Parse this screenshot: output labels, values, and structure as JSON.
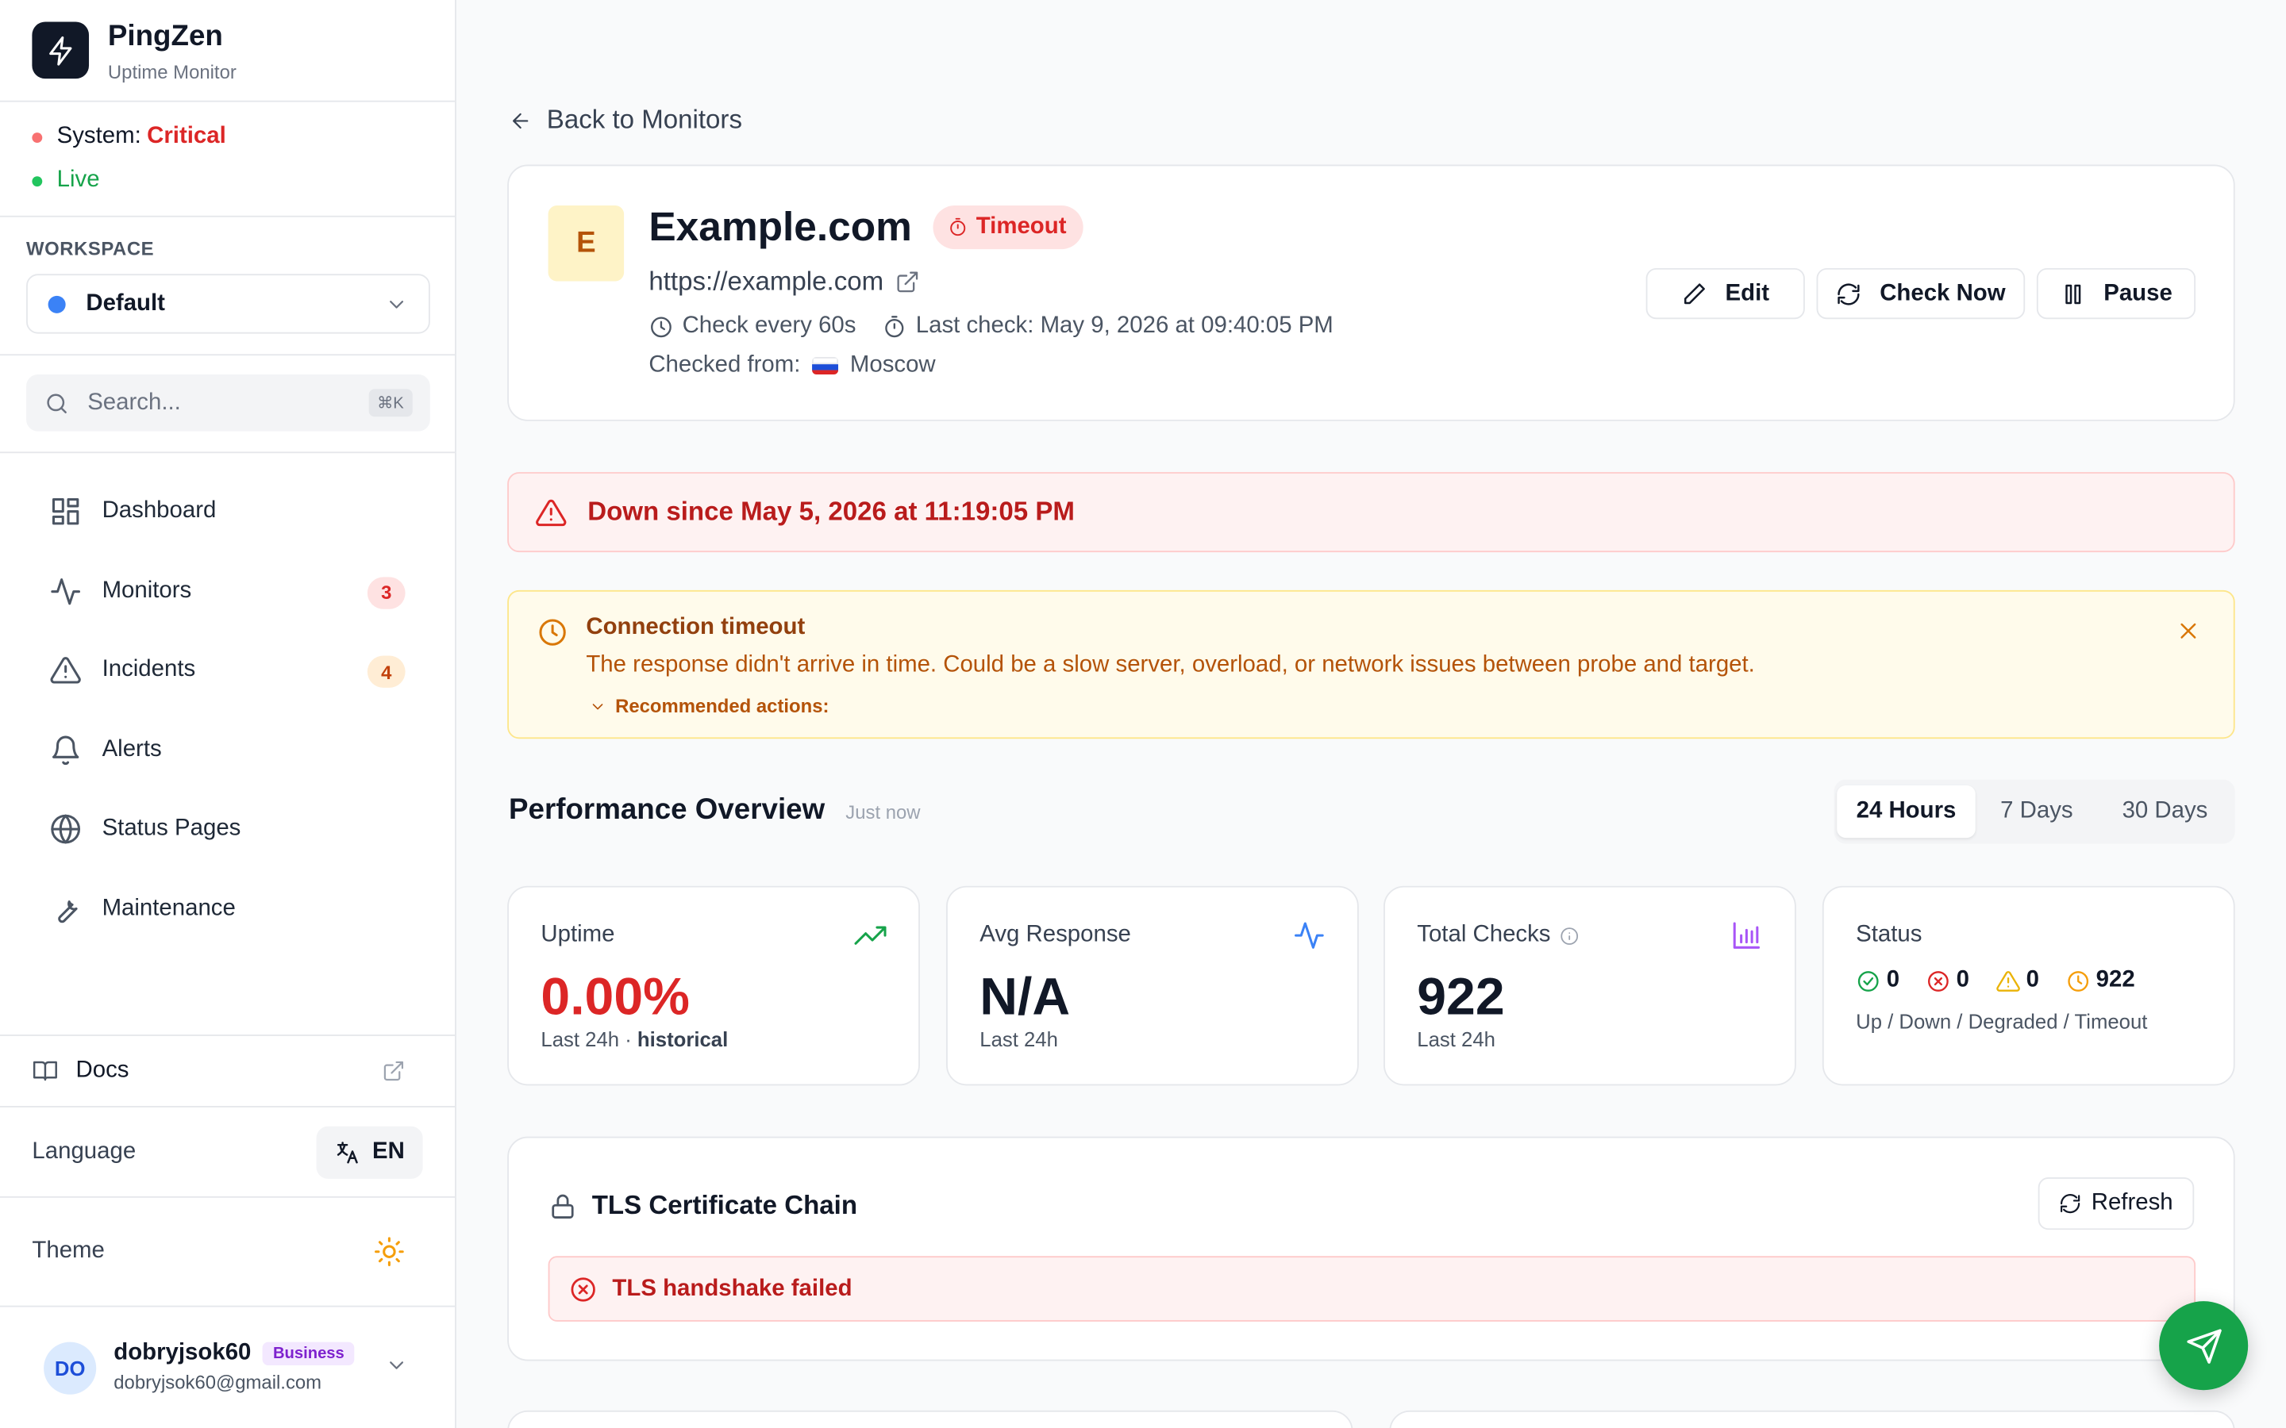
{
  "brand": {
    "name": "PingZen",
    "subtitle": "Uptime Monitor"
  },
  "system": {
    "label": "System:",
    "state": "Critical",
    "live": "Live"
  },
  "workspace": {
    "label": "WORKSPACE",
    "selected": "Default"
  },
  "search": {
    "placeholder": "Search...",
    "shortcut": "⌘K"
  },
  "nav": [
    {
      "label": "Dashboard",
      "icon": "dashboard-icon"
    },
    {
      "label": "Monitors",
      "icon": "activity-icon",
      "badge": "3"
    },
    {
      "label": "Incidents",
      "icon": "warning-icon",
      "badge": "4"
    },
    {
      "label": "Alerts",
      "icon": "bell-icon"
    },
    {
      "label": "Status Pages",
      "icon": "globe-icon"
    },
    {
      "label": "Maintenance",
      "icon": "wrench-icon"
    }
  ],
  "footer": {
    "docs": "Docs",
    "language_label": "Language",
    "language_value": "EN",
    "theme_label": "Theme"
  },
  "user": {
    "initials": "DO",
    "name": "dobryjsok60",
    "plan": "Business",
    "email": "dobryjsok60@gmail.com"
  },
  "back": "Back to Monitors",
  "monitor": {
    "initial": "E",
    "name": "Example.com",
    "status": "Timeout",
    "url": "https://example.com",
    "interval": "Check every 60s",
    "last_check": "Last check: May 9, 2026 at 09:40:05 PM",
    "checked_from_label": "Checked from:",
    "location": "Moscow",
    "actions": {
      "edit": "Edit",
      "check_now": "Check Now",
      "pause": "Pause"
    }
  },
  "down_banner": "Down since May 5, 2026 at 11:19:05 PM",
  "warning": {
    "title": "Connection timeout",
    "text": "The response didn't arrive in time. Could be a slow server, overload, or network issues between probe and target.",
    "recommended": "Recommended actions:"
  },
  "performance": {
    "title": "Performance Overview",
    "updated": "Just now",
    "ranges": [
      "24 Hours",
      "7 Days",
      "30 Days"
    ],
    "active_range": "24 Hours"
  },
  "stats": {
    "uptime": {
      "label": "Uptime",
      "value": "0.00%",
      "sub": "Last 24h ·",
      "sub_bold": "historical"
    },
    "avg_response": {
      "label": "Avg Response",
      "value": "N/A",
      "sub": "Last 24h"
    },
    "total_checks": {
      "label": "Total Checks",
      "value": "922",
      "sub": "Last 24h"
    },
    "status": {
      "label": "Status",
      "up": "0",
      "down": "0",
      "degraded": "0",
      "timeout": "922",
      "caption": "Up / Down / Degraded / Timeout"
    }
  },
  "tls": {
    "title": "TLS Certificate Chain",
    "refresh": "Refresh",
    "error": "TLS handshake failed"
  },
  "colors": {
    "critical": "#dc2626",
    "live": "#16a34a",
    "accent": "#3b82f6",
    "fab": "#16a34a"
  }
}
